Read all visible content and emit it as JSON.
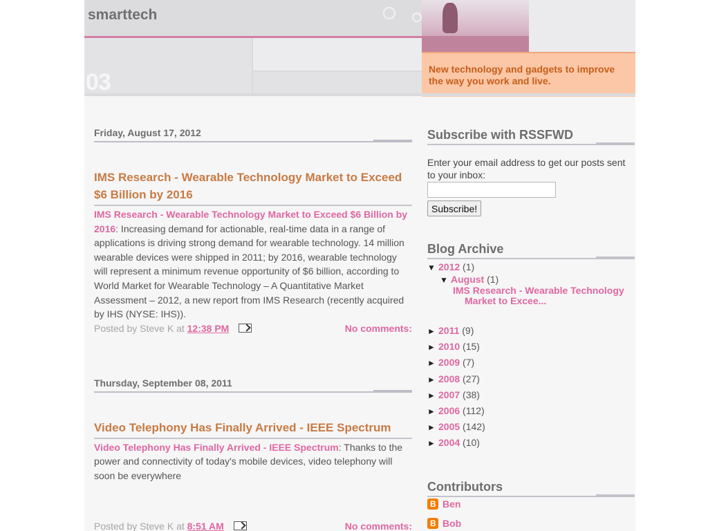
{
  "header": {
    "site_title": "smarttech",
    "tagline": "New technology and gadgets to improve the way you work and live.",
    "deco_number": "03"
  },
  "posts": [
    {
      "date": "Friday, August 17, 2012",
      "title": "IMS Research - Wearable Technology Market to Exceed $6 Billion by 2016",
      "link_text": "IMS Research - Wearable Technology Market to Exceed $6 Billion by 2016",
      "body": ": Increasing demand for actionable, real-time data in a range of applications is driving strong demand for wearable technology. 14 million wearable devices were shipped in 2011; by 2016, wearable technology will represent a minimum revenue opportunity of $6 billion, according to World Market for Wearable Technology – A Quantitative Market Assessment – 2012, a new report from IMS Research (recently acquired by IHS (NYSE: IHS)).",
      "posted_by": "Posted by Steve K at ",
      "time": "12:38 PM",
      "comments": "No comments:"
    },
    {
      "date": "Thursday, September 08, 2011",
      "title": "Video Telephony Has Finally Arrived - IEEE Spectrum",
      "link_text": "Video Telephony Has Finally Arrived - IEEE Spectrum",
      "body": ": Thanks to the power and connectivity of today's mobile devices, video telephony will soon be everywhere",
      "posted_by": "Posted by Steve K at ",
      "time": "8:51 AM",
      "comments": "No comments:"
    }
  ],
  "sidebar": {
    "subscribe": {
      "heading": "Subscribe with RSSFWD",
      "text": "Enter your email address to get our posts sent to your inbox:",
      "email_value": "",
      "button": "Subscribe!"
    },
    "archive": {
      "heading": "Blog Archive",
      "expanded_year": {
        "toggle": "▼",
        "label": "2012",
        "count": "(1)"
      },
      "expanded_month": {
        "toggle": "▼",
        "label": "August",
        "count": "(1)"
      },
      "post_line1": "IMS Research - Wearable Technology",
      "post_line2": "Market to Excee...",
      "years": [
        {
          "toggle": "►",
          "label": "2011",
          "count": "(9)"
        },
        {
          "toggle": "►",
          "label": "2010",
          "count": "(15)"
        },
        {
          "toggle": "►",
          "label": "2009",
          "count": "(7)"
        },
        {
          "toggle": "►",
          "label": "2008",
          "count": "(27)"
        },
        {
          "toggle": "►",
          "label": "2007",
          "count": "(38)"
        },
        {
          "toggle": "►",
          "label": "2006",
          "count": "(112)"
        },
        {
          "toggle": "►",
          "label": "2005",
          "count": "(142)"
        },
        {
          "toggle": "►",
          "label": "2004",
          "count": "(10)"
        }
      ]
    },
    "contributors": {
      "heading": "Contributors",
      "names": [
        "Ben",
        "Bob"
      ]
    }
  },
  "colors": {
    "link_pink": "#df67a1",
    "title_orange": "#c87a44",
    "tagline_orange": "#c65d1a",
    "tagline_bg": "#fcc7a6",
    "header_accent": "#d27fa5"
  }
}
